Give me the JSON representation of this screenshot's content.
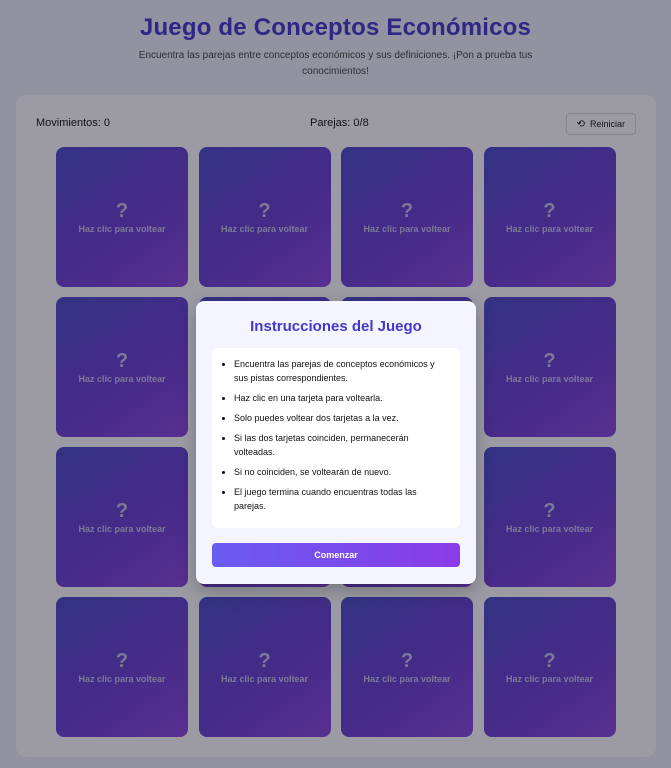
{
  "header": {
    "title": "Juego de Conceptos Económicos",
    "subtitle": "Encuentra las parejas entre conceptos económicos y sus definiciones. ¡Pon a prueba tus conocimientos!"
  },
  "stats": {
    "moves_label": "Movimientos: 0",
    "pairs_label": "Parejas: 0/8",
    "reset_label": "Reiniciar",
    "reset_icon": "refresh-icon"
  },
  "card": {
    "symbol": "?",
    "hint": "Haz clic para voltear",
    "count": 16
  },
  "modal": {
    "title": "Instrucciones del Juego",
    "rules": [
      "Encuentra las parejas de conceptos económicos y sus pistas correspondientes.",
      "Haz clic en una tarjeta para voltearla.",
      "Solo puedes voltear dos tarjetas a la vez.",
      "Si las dos tarjetas coinciden, permanecerán volteadas.",
      "Si no coinciden, se voltearán de nuevo.",
      "El juego termina cuando encuentras todas las parejas."
    ],
    "start_label": "Comenzar"
  },
  "colors": {
    "accent": "#4338ca",
    "card_gradient_start": "#4c4cc9",
    "card_gradient_end": "#8b47dd",
    "button_gradient_start": "#6a5cf0",
    "button_gradient_end": "#8a3be8"
  }
}
